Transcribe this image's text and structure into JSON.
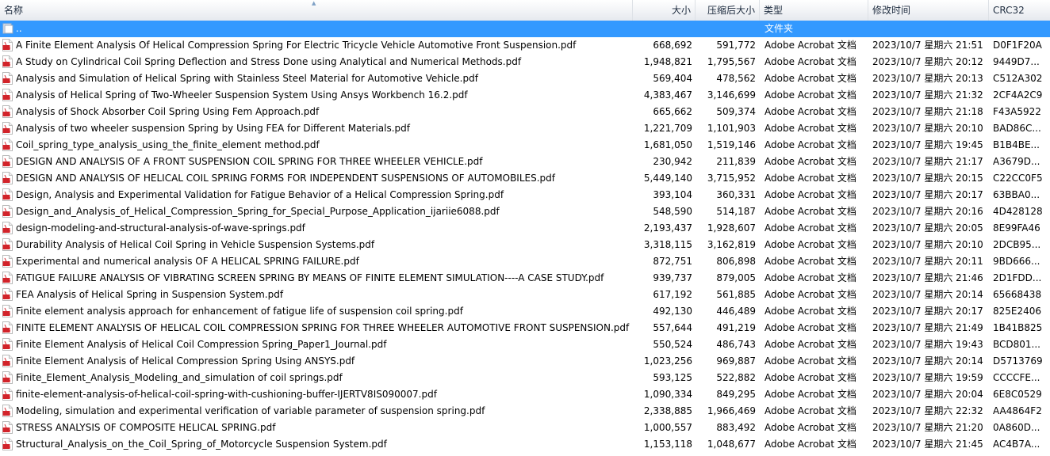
{
  "header": {
    "name": "名称",
    "size": "大小",
    "packed": "压缩后大小",
    "type": "类型",
    "modified": "修改时间",
    "crc": "CRC32"
  },
  "parent": {
    "name": "..",
    "type": "文件夹"
  },
  "rows": [
    {
      "name": "A Finite Element Analysis Of Helical Compression Spring For Electric Tricycle Vehicle Automotive Front Suspension.pdf",
      "size": "668,692",
      "packed": "591,772",
      "type": "Adobe Acrobat 文档",
      "modified": "2023/10/7 星期六 21:51",
      "crc": "D0F1F20A"
    },
    {
      "name": "A Study on Cylindrical Coil Spring Deflection and Stress Done using Analytical and Numerical Methods.pdf",
      "size": "1,948,821",
      "packed": "1,795,567",
      "type": "Adobe Acrobat 文档",
      "modified": "2023/10/7 星期六 20:12",
      "crc": "9449D7..."
    },
    {
      "name": "Analysis and Simulation of Helical Spring with Stainless Steel Material for Automotive Vehicle.pdf",
      "size": "569,404",
      "packed": "478,562",
      "type": "Adobe Acrobat 文档",
      "modified": "2023/10/7 星期六 20:13",
      "crc": "C512A302"
    },
    {
      "name": "Analysis of Helical Spring of Two-Wheeler Suspension System Using Ansys Workbench 16.2.pdf",
      "size": "4,383,467",
      "packed": "3,146,699",
      "type": "Adobe Acrobat 文档",
      "modified": "2023/10/7 星期六 21:32",
      "crc": "2CF4A2C9"
    },
    {
      "name": "Analysis of Shock Absorber Coil Spring Using Fem Approach.pdf",
      "size": "665,662",
      "packed": "509,374",
      "type": "Adobe Acrobat 文档",
      "modified": "2023/10/7 星期六 21:18",
      "crc": "F43A5922"
    },
    {
      "name": "Analysis of two wheeler suspension Spring by Using FEA for Different Materials.pdf",
      "size": "1,221,709",
      "packed": "1,101,903",
      "type": "Adobe Acrobat 文档",
      "modified": "2023/10/7 星期六 20:10",
      "crc": "BAD86C..."
    },
    {
      "name": "Coil_spring_type_analysis_using_the_finite_element method.pdf",
      "size": "1,681,050",
      "packed": "1,519,146",
      "type": "Adobe Acrobat 文档",
      "modified": "2023/10/7 星期六 19:45",
      "crc": "B1B4BE..."
    },
    {
      "name": "DESIGN AND ANALYSIS OF A FRONT SUSPENSION COIL SPRING FOR THREE WHEELER VEHICLE.pdf",
      "size": "230,942",
      "packed": "211,839",
      "type": "Adobe Acrobat 文档",
      "modified": "2023/10/7 星期六 21:17",
      "crc": "A3679D..."
    },
    {
      "name": "DESIGN AND ANALYSIS OF HELICAL COIL SPRING FORMS FOR INDEPENDENT SUSPENSIONS OF AUTOMOBILES.pdf",
      "size": "5,449,140",
      "packed": "3,715,952",
      "type": "Adobe Acrobat 文档",
      "modified": "2023/10/7 星期六 20:15",
      "crc": "C22CC0F5"
    },
    {
      "name": "Design, Analysis and Experimental Validation for Fatigue Behavior of a Helical Compression Spring.pdf",
      "size": "393,104",
      "packed": "360,331",
      "type": "Adobe Acrobat 文档",
      "modified": "2023/10/7 星期六 20:17",
      "crc": "63BBA0..."
    },
    {
      "name": "Design_and_Analysis_of_Helical_Compression_Spring_for_Special_Purpose_Application_ijariie6088.pdf",
      "size": "548,590",
      "packed": "514,187",
      "type": "Adobe Acrobat 文档",
      "modified": "2023/10/7 星期六 20:16",
      "crc": "4D428128"
    },
    {
      "name": "design-modeling-and-structural-analysis-of-wave-springs.pdf",
      "size": "2,193,437",
      "packed": "1,928,607",
      "type": "Adobe Acrobat 文档",
      "modified": "2023/10/7 星期六 20:05",
      "crc": "8E99FA46"
    },
    {
      "name": "Durability Analysis of Helical Coil Spring in Vehicle Suspension Systems.pdf",
      "size": "3,318,115",
      "packed": "3,162,819",
      "type": "Adobe Acrobat 文档",
      "modified": "2023/10/7 星期六 20:10",
      "crc": "2DCB95..."
    },
    {
      "name": "Experimental and numerical analysis OF A HELICAL SPRING FAILURE.pdf",
      "size": "872,751",
      "packed": "806,898",
      "type": "Adobe Acrobat 文档",
      "modified": "2023/10/7 星期六 20:11",
      "crc": "9BD666..."
    },
    {
      "name": "FATIGUE FAILURE ANALYSIS OF VIBRATING SCREEN SPRING BY MEANS OF FINITE ELEMENT SIMULATION----A CASE STUDY.pdf",
      "size": "939,737",
      "packed": "879,005",
      "type": "Adobe Acrobat 文档",
      "modified": "2023/10/7 星期六 21:46",
      "crc": "2D1FDD..."
    },
    {
      "name": "FEA Analysis of Helical Spring in Suspension System.pdf",
      "size": "617,192",
      "packed": "561,885",
      "type": "Adobe Acrobat 文档",
      "modified": "2023/10/7 星期六 20:14",
      "crc": "65668438"
    },
    {
      "name": "Finite element analysis approach for enhancement of fatigue life of suspension coil spring.pdf",
      "size": "492,130",
      "packed": "446,489",
      "type": "Adobe Acrobat 文档",
      "modified": "2023/10/7 星期六 20:17",
      "crc": "825E2406"
    },
    {
      "name": "FINITE ELEMENT ANALYSIS OF HELICAL COIL COMPRESSION SPRING FOR THREE WHEELER AUTOMOTIVE FRONT SUSPENSION.pdf",
      "size": "557,644",
      "packed": "491,219",
      "type": "Adobe Acrobat 文档",
      "modified": "2023/10/7 星期六 21:49",
      "crc": "1B41B825"
    },
    {
      "name": "Finite Element Analysis of Helical Coil Compression Spring_Paper1_Journal.pdf",
      "size": "550,524",
      "packed": "486,743",
      "type": "Adobe Acrobat 文档",
      "modified": "2023/10/7 星期六 19:43",
      "crc": "BCD801..."
    },
    {
      "name": "Finite Element Analysis of Helical Compression Spring Using ANSYS.pdf",
      "size": "1,023,256",
      "packed": "969,887",
      "type": "Adobe Acrobat 文档",
      "modified": "2023/10/7 星期六 20:14",
      "crc": "D5713769"
    },
    {
      "name": "Finite_Element_Analysis_Modeling_and_simulation of coil springs.pdf",
      "size": "593,125",
      "packed": "522,882",
      "type": "Adobe Acrobat 文档",
      "modified": "2023/10/7 星期六 19:59",
      "crc": "CCCCFE..."
    },
    {
      "name": "finite-element-analysis-of-helical-coil-spring-with-cushioning-buffer-IJERTV8IS090007.pdf",
      "size": "1,090,334",
      "packed": "849,295",
      "type": "Adobe Acrobat 文档",
      "modified": "2023/10/7 星期六 20:04",
      "crc": "6E8C0529"
    },
    {
      "name": "Modeling, simulation and experimental verification of variable parameter of suspension spring.pdf",
      "size": "2,338,885",
      "packed": "1,966,469",
      "type": "Adobe Acrobat 文档",
      "modified": "2023/10/7 星期六 22:32",
      "crc": "AA4864F2"
    },
    {
      "name": "STRESS ANALYSIS OF COMPOSITE HELICAL SPRING.pdf",
      "size": "1,000,557",
      "packed": "883,492",
      "type": "Adobe Acrobat 文档",
      "modified": "2023/10/7 星期六 21:20",
      "crc": "0A860D..."
    },
    {
      "name": "Structural_Analysis_on_the_Coil_Spring_of_Motorcycle Suspension System.pdf",
      "size": "1,153,118",
      "packed": "1,048,677",
      "type": "Adobe Acrobat 文档",
      "modified": "2023/10/7 星期六 21:45",
      "crc": "AC4B7A..."
    }
  ]
}
